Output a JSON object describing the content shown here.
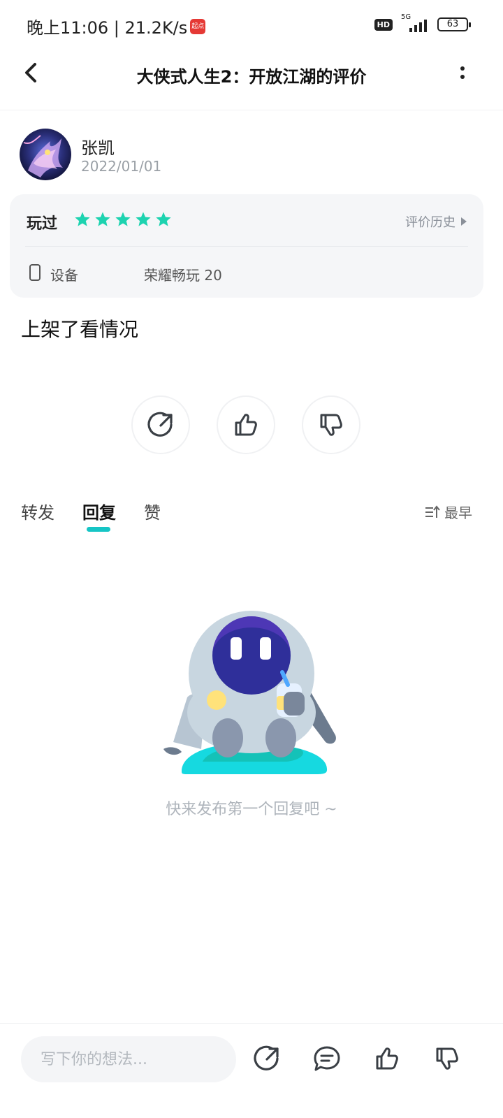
{
  "status_bar": {
    "time_speed": "晚上11:06 | 21.2K/s",
    "app_badge": "起点",
    "hd": "HD",
    "network": "5G",
    "battery": "63"
  },
  "header": {
    "title": "大侠式人生2：开放江湖的评价"
  },
  "author": {
    "name": "张凯",
    "date": "2022/01/01"
  },
  "review_card": {
    "played_label": "玩过",
    "rating": 5,
    "history_label": "评价历史",
    "device_label": "设备",
    "device_value": "荣耀畅玩 20",
    "accent": "#1dd3b0"
  },
  "review_text": "上架了看情况",
  "tabs": [
    {
      "label": "转发"
    },
    {
      "label": "回复"
    },
    {
      "label": "赞"
    }
  ],
  "active_tab": "回复",
  "sort_label": "最早",
  "empty_text": "快来发布第一个回复吧 ~",
  "bottom_bar": {
    "placeholder": "写下你的想法..."
  },
  "icons": [
    "back-icon",
    "more-icon",
    "share-icon",
    "like-icon",
    "dislike-icon",
    "comment-icon",
    "sort-icon",
    "device-icon"
  ]
}
